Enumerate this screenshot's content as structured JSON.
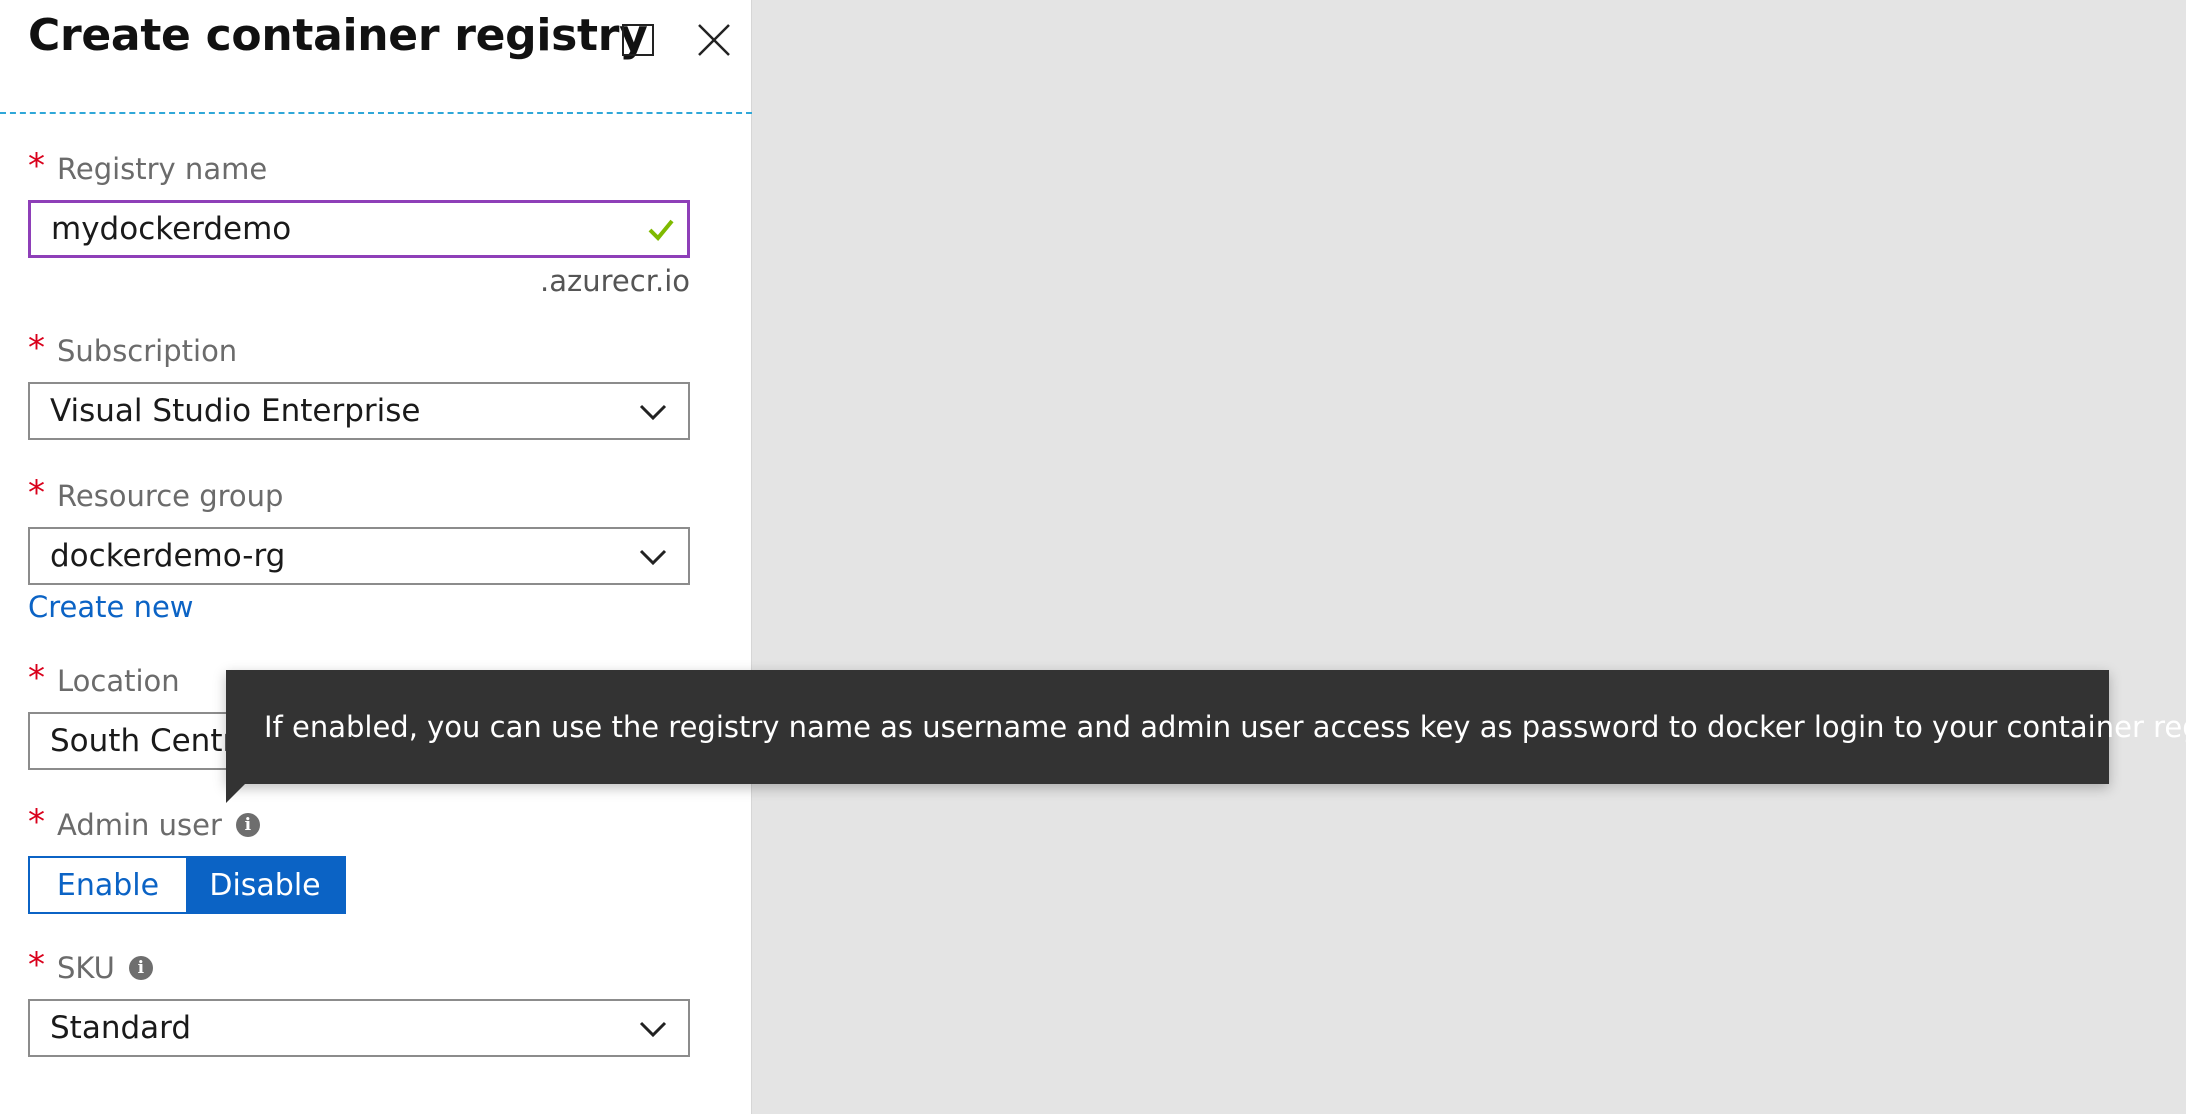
{
  "blade": {
    "title": "Create container registry"
  },
  "fields": {
    "registry_name": {
      "label": "Registry name",
      "value": "mydockerdemo",
      "suffix": ".azurecr.io"
    },
    "subscription": {
      "label": "Subscription",
      "value": "Visual Studio Enterprise"
    },
    "resource_group": {
      "label": "Resource group",
      "value": "dockerdemo-rg",
      "create_new_label": "Create new"
    },
    "location": {
      "label": "Location",
      "value": "South Central US"
    },
    "admin_user": {
      "label": "Admin user",
      "options": [
        "Enable",
        "Disable"
      ],
      "selected": "Disable"
    },
    "sku": {
      "label": "SKU",
      "value": "Standard"
    }
  },
  "required_marker": "*",
  "tooltip": {
    "text": "If enabled, you can use the registry name as username and admin user access key as password to docker login to your container registry."
  },
  "colors": {
    "required": "#d9001b",
    "accent": "#0b63c5",
    "active_border": "#8e3fb8",
    "valid_check": "#7fba00",
    "tooltip_bg": "#333333"
  }
}
